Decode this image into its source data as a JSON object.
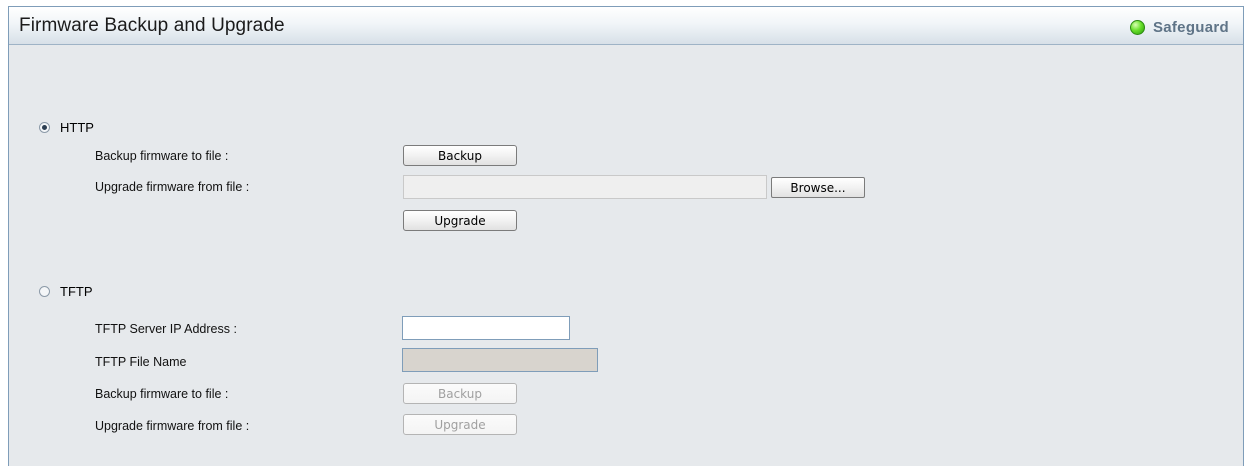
{
  "header": {
    "title": "Firmware Backup and Upgrade",
    "safeguard_label": "Safeguard",
    "safeguard_color": "#4cd11a"
  },
  "http": {
    "radio_label": "HTTP",
    "selected": true,
    "backup_label": "Backup firmware to file :",
    "backup_button": "Backup",
    "upgrade_label": "Upgrade firmware from file :",
    "file_value": "",
    "browse_button": "Browse...",
    "upgrade_button": "Upgrade"
  },
  "tftp": {
    "radio_label": "TFTP",
    "selected": false,
    "server_ip_label": "TFTP Server IP Address :",
    "server_ip_value": "",
    "file_name_label": "TFTP File Name",
    "file_name_value": "",
    "backup_label": "Backup firmware to file :",
    "backup_button": "Backup",
    "upgrade_label": "Upgrade firmware from file :",
    "upgrade_button": "Upgrade"
  }
}
